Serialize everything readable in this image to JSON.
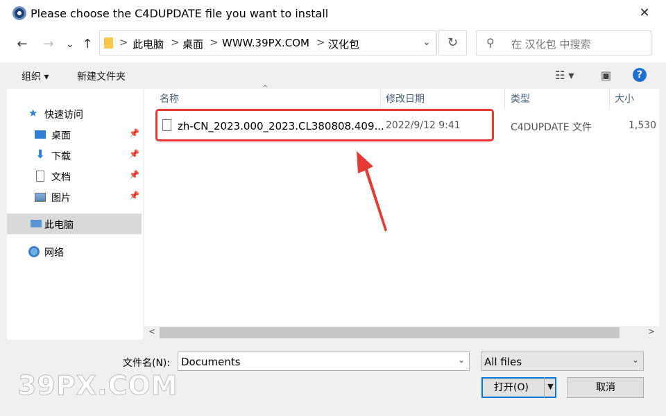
{
  "window": {
    "title": "Please choose the C4DUPDATE file you want to install",
    "close_label": "✕"
  },
  "nav": {
    "back": "←",
    "forward": "→",
    "recent": "⌄",
    "up": "↑",
    "breadcrumbs": [
      "此电脑",
      "桌面",
      "WWW.39PX.COM",
      "汉化包"
    ],
    "separator": ">",
    "address_dropdown": "⌄",
    "refresh": "↻",
    "search_placeholder": "在 汉化包 中搜索",
    "search_icon": "⚲"
  },
  "toolbar": {
    "organize": "组织 ▾",
    "new_folder": "新建文件夹",
    "view_icon": "☷ ▾",
    "pane_icon": "▣",
    "help_icon": "?"
  },
  "sidebar": {
    "items": [
      {
        "label": "快速访问",
        "icon": "star-icon"
      },
      {
        "label": "桌面",
        "icon": "desktop-icon",
        "pinned": true
      },
      {
        "label": "下载",
        "icon": "download-icon",
        "pinned": true
      },
      {
        "label": "文档",
        "icon": "document-icon",
        "pinned": true
      },
      {
        "label": "图片",
        "icon": "picture-icon",
        "pinned": true
      },
      {
        "label": "此电脑",
        "icon": "computer-icon",
        "selected": true
      },
      {
        "label": "网络",
        "icon": "network-icon"
      }
    ],
    "pin_glyph": "📌"
  },
  "columns": {
    "name": "名称",
    "modified": "修改日期",
    "type": "类型",
    "size": "大小"
  },
  "files": [
    {
      "name": "zh-CN_2023.000_2023.CL380808.409...",
      "modified": "2022/9/12 9:41",
      "type": "C4DUPDATE 文件",
      "size": "1,530"
    }
  ],
  "footer": {
    "filename_label": "文件名(N):",
    "filename_value": "Documents",
    "filetype_value": "All files",
    "open_label": "打开(O)",
    "cancel_label": "取消"
  },
  "watermark": "39PX.COM",
  "colors": {
    "annotation": "#e53935",
    "accent": "#0078d7"
  }
}
